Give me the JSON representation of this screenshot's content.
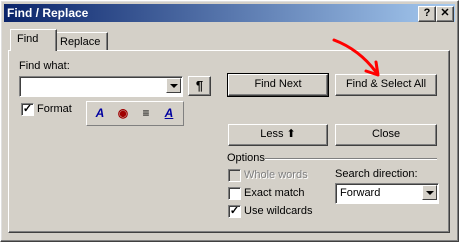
{
  "window": {
    "title": "Find / Replace"
  },
  "titlebar": {
    "help_glyph": "?",
    "close_glyph": "✕"
  },
  "tabs": [
    {
      "label": "Find",
      "active": true
    },
    {
      "label": "Replace",
      "active": false
    }
  ],
  "find": {
    "label": "Find what:",
    "value": "",
    "pilcrow": "¶"
  },
  "format": {
    "label": "Format",
    "checked": true
  },
  "buttons": {
    "find_next": "Find Next",
    "find_select_all": "Find & Select All",
    "less": "Less ⬆",
    "close": "Close"
  },
  "options": {
    "heading": "Options",
    "whole_words": {
      "label": "Whole words",
      "checked": false,
      "enabled": false
    },
    "exact_match": {
      "label": "Exact match",
      "checked": false,
      "enabled": true
    },
    "use_wildcards": {
      "label": "Use wildcards",
      "checked": true,
      "enabled": true
    },
    "direction_label": "Search direction:",
    "direction_value": "Forward"
  },
  "colors": {
    "title_start": "#0a246a",
    "title_end": "#a6caf0",
    "annotation_arrow": "#ff0000"
  },
  "icons": [
    "format-font-icon",
    "format-color-icon",
    "format-paragraph-icon",
    "format-style-icon"
  ]
}
